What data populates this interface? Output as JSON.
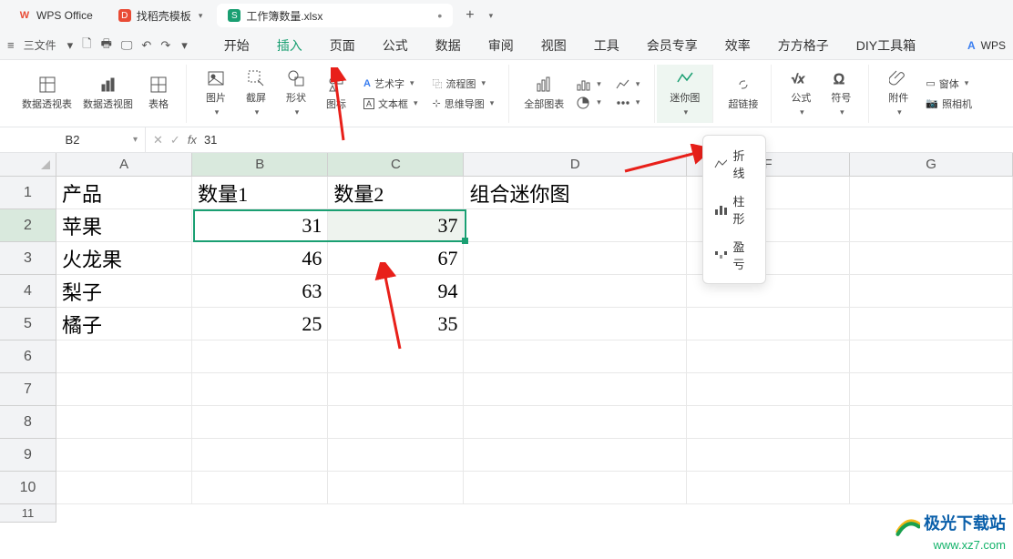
{
  "tabs": {
    "home": "WPS Office",
    "tpl": "找稻壳模板",
    "file": "工作簿数量.xlsx",
    "add": "+",
    "tpl_dd": "▾"
  },
  "menubar": {
    "left": {
      "hamburger": "≡",
      "file": "三文件",
      "undo": "⟲",
      "redo": "⟳",
      "save": "🖫",
      "print": "🖶",
      "more": "⋯"
    },
    "tabs": [
      "开始",
      "插入",
      "页面",
      "公式",
      "数据",
      "审阅",
      "视图",
      "工具",
      "会员专享",
      "效率",
      "方方格子",
      "DIY工具箱"
    ],
    "active_index": 1,
    "wps": "WPS"
  },
  "ribbon": {
    "pivot_table": "数据透视表",
    "pivot_view": "数据透视图",
    "table": "表格",
    "picture": "图片",
    "screenshot": "截屏",
    "shape": "形状",
    "icon": "图标",
    "wordart": "艺术字",
    "textbox": "文本框",
    "flowchart": "流程图",
    "mindmap": "思维导图",
    "allcharts": "全部图表",
    "sparkline": "迷你图",
    "hyperlink": "超链接",
    "formula": "公式",
    "symbol": "符号",
    "attach": "附件",
    "camera": "照相机",
    "form": "窗体"
  },
  "namebox": {
    "cell": "B2",
    "fx": "fx",
    "value": "31"
  },
  "cols": [
    "A",
    "B",
    "C",
    "D",
    "E",
    "F",
    "G"
  ],
  "rows": [
    "1",
    "2",
    "3",
    "4",
    "5",
    "6",
    "7",
    "8",
    "9",
    "10",
    "11"
  ],
  "data": {
    "r1": {
      "A": "产品",
      "B": "数量1",
      "C": "数量2",
      "D": "组合迷你图"
    },
    "r2": {
      "A": "苹果",
      "B": "31",
      "C": "37"
    },
    "r3": {
      "A": "火龙果",
      "B": "46",
      "C": "67"
    },
    "r4": {
      "A": "梨子",
      "B": "63",
      "C": "94"
    },
    "r5": {
      "A": "橘子",
      "B": "25",
      "C": "35"
    }
  },
  "sparkline_menu": {
    "line": "折线",
    "column": "柱形",
    "winloss": "盈亏"
  },
  "watermark": {
    "title": "极光下载站",
    "url": "www.xz7.com"
  },
  "chart_data": {
    "type": "table",
    "title": "",
    "columns": [
      "产品",
      "数量1",
      "数量2"
    ],
    "rows": [
      [
        "苹果",
        31,
        37
      ],
      [
        "火龙果",
        46,
        67
      ],
      [
        "梨子",
        63,
        94
      ],
      [
        "橘子",
        25,
        35
      ]
    ]
  }
}
